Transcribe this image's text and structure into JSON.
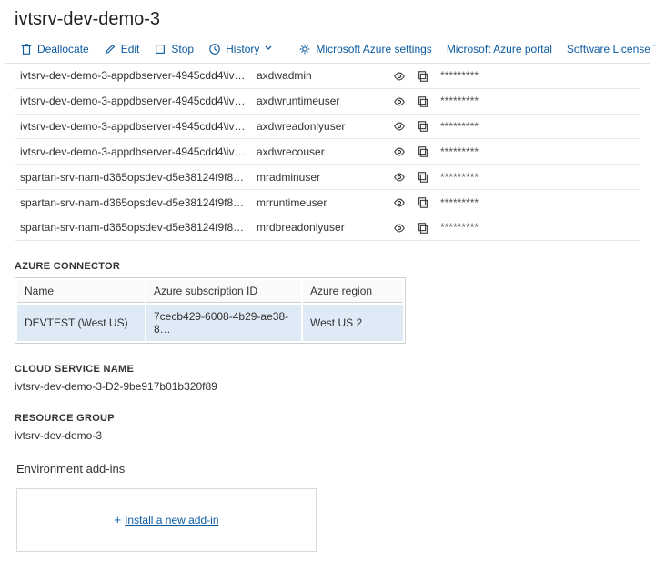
{
  "title": "ivtsrv-dev-demo-3",
  "toolbar": {
    "deallocate": "Deallocate",
    "edit": "Edit",
    "stop": "Stop",
    "history": "History",
    "azure_settings": "Microsoft Azure settings",
    "azure_portal": "Microsoft Azure portal",
    "license_terms": "Software License Terms"
  },
  "creds": [
    {
      "server": "ivtsrv-dev-demo-3-appdbserver-4945cdd4\\ivtsrv-d…",
      "user": "axdwadmin",
      "password": "*********"
    },
    {
      "server": "ivtsrv-dev-demo-3-appdbserver-4945cdd4\\ivtsrv-d…",
      "user": "axdwruntimeuser",
      "password": "*********"
    },
    {
      "server": "ivtsrv-dev-demo-3-appdbserver-4945cdd4\\ivtsrv-d…",
      "user": "axdwreadonlyuser",
      "password": "*********"
    },
    {
      "server": "ivtsrv-dev-demo-3-appdbserver-4945cdd4\\ivtsrv-d…",
      "user": "axdwrecouser",
      "password": "*********"
    },
    {
      "server": "spartan-srv-nam-d365opsdev-d5e38124f9f8\\db_d3…",
      "user": "mradminuser",
      "password": "*********"
    },
    {
      "server": "spartan-srv-nam-d365opsdev-d5e38124f9f8\\db_d3…",
      "user": "mrruntimeuser",
      "password": "*********"
    },
    {
      "server": "spartan-srv-nam-d365opsdev-d5e38124f9f8\\db_d3…",
      "user": "mrdbreadonlyuser",
      "password": "*********"
    }
  ],
  "azure_connector": {
    "heading": "AZURE CONNECTOR",
    "columns": {
      "name": "Name",
      "sub": "Azure subscription ID",
      "region": "Azure region"
    },
    "row": {
      "name": "DEVTEST (West US)",
      "sub": "7cecb429-6008-4b29-ae38-8…",
      "region": "West US 2"
    }
  },
  "cloud_service": {
    "heading": "CLOUD SERVICE NAME",
    "value": "ivtsrv-dev-demo-3-D2-9be917b01b320f89"
  },
  "resource_group": {
    "heading": "RESOURCE GROUP",
    "value": "ivtsrv-dev-demo-3"
  },
  "addins": {
    "heading": "Environment add-ins",
    "install": "Install a new add-in"
  }
}
